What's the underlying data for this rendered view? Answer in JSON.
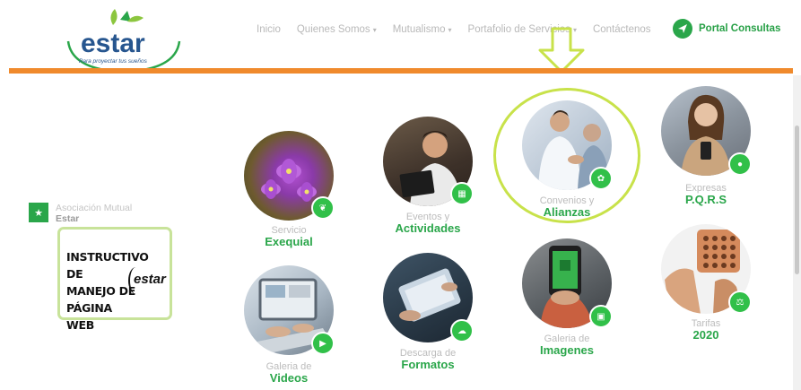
{
  "logo": {
    "brand": "estar",
    "tagline": "Para proyectar tus sueños"
  },
  "nav": {
    "items": [
      {
        "label": "Inicio",
        "dropdown": false
      },
      {
        "label": "Quienes Somos",
        "dropdown": true
      },
      {
        "label": "Mutualismo",
        "dropdown": true
      },
      {
        "label": "Portafolio de Servicios",
        "dropdown": true
      },
      {
        "label": "Contáctenos",
        "dropdown": false
      }
    ],
    "portal": "Portal Consultas"
  },
  "sidebar": {
    "title": "Asociación Mutual",
    "subtitle": "Estar"
  },
  "instructivo": {
    "lines": [
      "INSTRUCTIVO DE",
      "MANEJO DE",
      "PÁGINA WEB"
    ],
    "logo": "estar"
  },
  "services": [
    {
      "line1": "Servicio",
      "line2": "Exequial",
      "icon": "leaf-icon"
    },
    {
      "line1": "Eventos y",
      "line2": "Actividades",
      "icon": "calendar-icon"
    },
    {
      "line1": "Convenios y",
      "line2": "Alianzas",
      "icon": "handshake-icon"
    },
    {
      "line1": "Expresas",
      "line2": "P.Q.R.S",
      "icon": "chat-icon"
    },
    {
      "line1": "Galeria de",
      "line2": "Videos",
      "icon": "play-icon"
    },
    {
      "line1": "Descarga de",
      "line2": "Formatos",
      "icon": "download-icon"
    },
    {
      "line1": "Galeria de",
      "line2": "Imagenes",
      "icon": "image-icon"
    },
    {
      "line1": "Tarifas",
      "line2": "2020",
      "icon": "scale-icon"
    }
  ],
  "colors": {
    "brand_green": "#2aa64a",
    "orange": "#f08a2c",
    "highlight": "#c8e24a"
  }
}
